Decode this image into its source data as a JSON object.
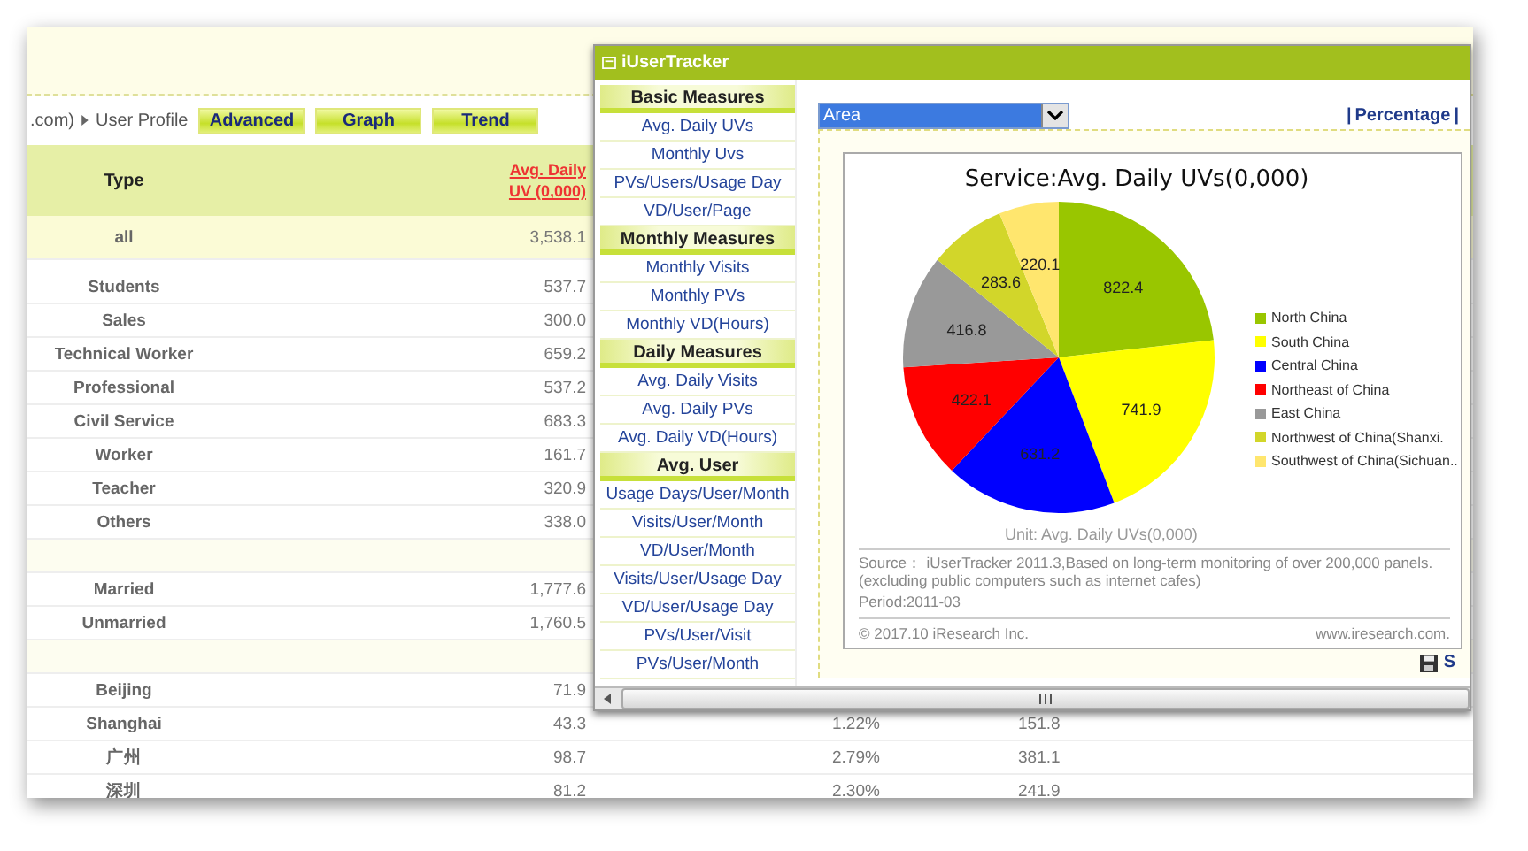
{
  "breadcrumb": {
    "text": ".com)",
    "current": "User Profile"
  },
  "view_buttons": [
    "Advanced",
    "Graph",
    "Trend"
  ],
  "table": {
    "columns": [
      "Type",
      "Avg. Daily UV (0,000)"
    ],
    "rows": [
      {
        "kind": "total",
        "cells": [
          "all",
          "3,538.1"
        ]
      },
      {
        "kind": "data",
        "cells": [
          "Students",
          "537.7"
        ]
      },
      {
        "kind": "data",
        "cells": [
          "Sales",
          "300.0"
        ]
      },
      {
        "kind": "data",
        "cells": [
          "Technical Worker",
          "659.2"
        ]
      },
      {
        "kind": "data",
        "cells": [
          "Professional",
          "537.2"
        ]
      },
      {
        "kind": "data",
        "cells": [
          "Civil Service",
          "683.3"
        ]
      },
      {
        "kind": "data",
        "cells": [
          "Worker",
          "161.7"
        ]
      },
      {
        "kind": "data",
        "cells": [
          "Teacher",
          "320.9"
        ]
      },
      {
        "kind": "data",
        "cells": [
          "Others",
          "338.0"
        ]
      },
      {
        "kind": "gap"
      },
      {
        "kind": "data",
        "cells": [
          "Married",
          "1,777.6"
        ]
      },
      {
        "kind": "data",
        "cells": [
          "Unmarried",
          "1,760.5"
        ]
      },
      {
        "kind": "gap"
      },
      {
        "kind": "data",
        "cells": [
          "Beijing",
          "71.9"
        ]
      },
      {
        "kind": "data",
        "cells": [
          "Shanghai",
          "43.3",
          "1.22%",
          "151.8"
        ]
      },
      {
        "kind": "data",
        "cells": [
          "广州",
          "98.7",
          "2.79%",
          "381.1"
        ]
      },
      {
        "kind": "data",
        "cells": [
          "深圳",
          "81.2",
          "2.30%",
          "241.9"
        ]
      }
    ]
  },
  "window": {
    "title": "iUserTracker",
    "sidebar": [
      {
        "title": "Basic Measures",
        "items": [
          "Avg. Daily UVs",
          "Monthly Uvs",
          "PVs/Users/Usage Day",
          "VD/User/Page"
        ]
      },
      {
        "title": "Monthly Measures",
        "items": [
          "Monthly Visits",
          "Monthly PVs",
          "Monthly VD(Hours)"
        ]
      },
      {
        "title": "Daily Measures",
        "items": [
          "Avg. Daily Visits",
          "Avg. Daily PVs",
          "Avg. Daily VD(Hours)"
        ]
      },
      {
        "title": "Avg. User",
        "items": [
          "Usage Days/User/Month",
          "Visits/User/Month",
          "VD/User/Month",
          "Visits/User/Usage Day",
          "VD/User/Usage Day",
          "PVs/User/Visit",
          "PVs/User/Month"
        ]
      }
    ],
    "dimension_select": {
      "value": "Area"
    },
    "percentage_bar": {
      "left": "|",
      "label": "Percentage",
      "right": "|"
    },
    "chart_data": {
      "type": "pie",
      "title": "Service:Avg. Daily UVs(0,000)",
      "legend": "right",
      "data_labels": true,
      "categories": [
        "North China",
        "South China",
        "Central China",
        "Northeast of China",
        "East China",
        "Northwest of China(Shanxi.",
        "Southwest of China(Sichuan.."
      ],
      "value_labels": [
        "822.4",
        "741.9",
        "631.2",
        "422.1",
        "416.8",
        "283.6",
        "220.1"
      ],
      "colors": [
        "#99c600",
        "#ffff00",
        "#0000ff",
        "#ff0000",
        "#999999",
        "#d2d62a",
        "#ffe66e"
      ],
      "values": [
        822.4,
        741.9,
        631.2,
        422.1,
        416.8,
        283.6,
        220.1
      ]
    },
    "unit": "Unit: Avg. Daily UVs(0,000)",
    "source": "Source： iUserTracker 2011.3,Based on long-term monitoring of over 200,000 panels. (excluding public computers such as internet cafes)",
    "period": "Period:2011-03",
    "copyright": "© 2017.10 iResearch Inc.",
    "website": "www.iresearch.com.",
    "save_link": "S"
  }
}
